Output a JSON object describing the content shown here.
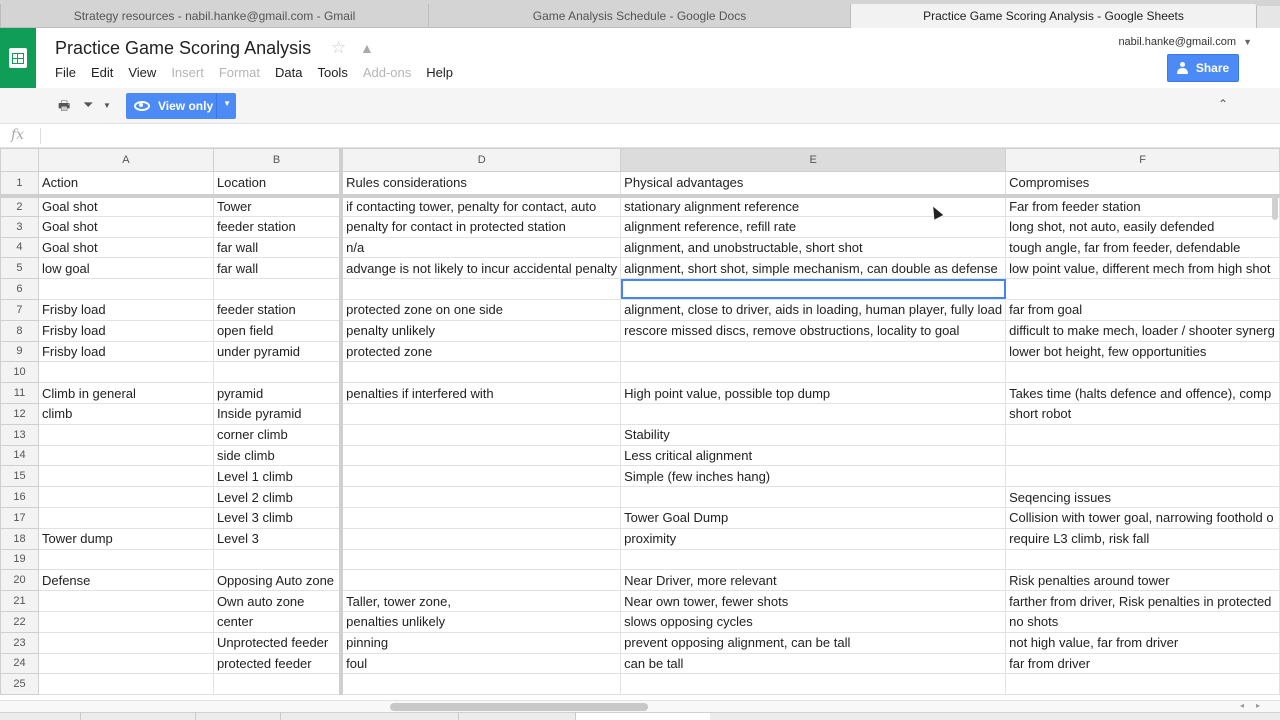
{
  "browser": {
    "tabs": [
      {
        "title": "Strategy resources - nabil.hanke@gmail.com - Gmail",
        "active": false
      },
      {
        "title": "Game Analysis Schedule - Google Docs",
        "active": false
      },
      {
        "title": "Practice Game Scoring Analysis - Google Sheets",
        "active": true
      }
    ]
  },
  "header": {
    "title": "Practice Game Scoring Analysis",
    "user_email": "nabil.hanke@gmail.com",
    "share_label": "Share",
    "menu": [
      {
        "label": "File",
        "enabled": true
      },
      {
        "label": "Edit",
        "enabled": true
      },
      {
        "label": "View",
        "enabled": true
      },
      {
        "label": "Insert",
        "enabled": false
      },
      {
        "label": "Format",
        "enabled": false
      },
      {
        "label": "Data",
        "enabled": true
      },
      {
        "label": "Tools",
        "enabled": true
      },
      {
        "label": "Add-ons",
        "enabled": false
      },
      {
        "label": "Help",
        "enabled": true
      }
    ]
  },
  "toolbar": {
    "view_only_label": "View only"
  },
  "formula_bar": {
    "fx_label": "fx",
    "value": ""
  },
  "sheet": {
    "column_headers": [
      "A",
      "B",
      "D",
      "E",
      "F"
    ],
    "selected_column": "E",
    "selected_cell": {
      "row": 6,
      "col": "E"
    },
    "rows": [
      {
        "num": "1",
        "cells": [
          "Action",
          "Location",
          "Rules considerations",
          "Physical advantages",
          "Compromises"
        ]
      },
      {
        "num": "2",
        "cells": [
          "Goal shot",
          "Tower",
          "if contacting tower, penalty for contact, auto",
          "stationary alignment reference",
          "Far from feeder station"
        ]
      },
      {
        "num": "3",
        "cells": [
          "Goal shot",
          "feeder station",
          "penalty for contact in protected station",
          "alignment reference, refill rate",
          "long shot, not auto, easily defended"
        ]
      },
      {
        "num": "4",
        "cells": [
          "Goal shot",
          "far wall",
          "n/a",
          "alignment, and unobstructable, short shot",
          "tough angle, far from feeder, defendable"
        ]
      },
      {
        "num": "5",
        "cells": [
          "low goal",
          "far wall",
          "advange is not likely to incur accidental penalty",
          "alignment, short shot, simple mechanism, can double as defense",
          "low point value, different mech from high shot"
        ]
      },
      {
        "num": "6",
        "cells": [
          "",
          "",
          "",
          "",
          ""
        ]
      },
      {
        "num": "7",
        "cells": [
          "Frisby load",
          "feeder station",
          "protected zone on one side",
          "alignment, close to driver, aids in loading, human player, fully load",
          "far from goal"
        ]
      },
      {
        "num": "8",
        "cells": [
          "Frisby load",
          "open field",
          "penalty unlikely",
          "rescore missed discs, remove obstructions, locality to goal",
          "difficult to make mech, loader / shooter synerg"
        ]
      },
      {
        "num": "9",
        "cells": [
          "Frisby load",
          "under pyramid",
          "protected zone",
          "",
          "lower bot height, few opportunities"
        ]
      },
      {
        "num": "10",
        "cells": [
          "",
          "",
          "",
          "",
          ""
        ]
      },
      {
        "num": "11",
        "cells": [
          "Climb in general",
          "pyramid",
          "penalties if interfered with",
          "High point value, possible top dump",
          "Takes time (halts defence and offence), comp"
        ]
      },
      {
        "num": "12",
        "cells": [
          "climb",
          "Inside pyramid",
          "",
          "",
          "short robot"
        ]
      },
      {
        "num": "13",
        "cells": [
          "",
          "corner climb",
          "",
          "Stability",
          ""
        ]
      },
      {
        "num": "14",
        "cells": [
          "",
          "side climb",
          "",
          "Less critical alignment",
          ""
        ]
      },
      {
        "num": "15",
        "cells": [
          "",
          "Level 1 climb",
          "",
          "Simple (few inches hang)",
          ""
        ]
      },
      {
        "num": "16",
        "cells": [
          "",
          "Level 2 climb",
          "",
          "",
          "Seqencing issues"
        ]
      },
      {
        "num": "17",
        "cells": [
          "",
          "Level 3 climb",
          "",
          "Tower Goal Dump",
          "Collision with tower goal, narrowing foothold o"
        ]
      },
      {
        "num": "18",
        "cells": [
          "Tower dump",
          "Level 3",
          "",
          "proximity",
          "require L3 climb, risk fall"
        ]
      },
      {
        "num": "19",
        "cells": [
          "",
          "",
          "",
          "",
          ""
        ]
      },
      {
        "num": "20",
        "cells": [
          "Defense",
          "Opposing Auto zone",
          "",
          "Near Driver, more relevant",
          "Risk penalties around tower"
        ]
      },
      {
        "num": "21",
        "cells": [
          "",
          "Own auto zone",
          "Taller, tower zone,",
          "Near own tower, fewer shots",
          "farther from driver, Risk penalties in protected"
        ]
      },
      {
        "num": "22",
        "cells": [
          "",
          "center",
          "penalties unlikely",
          "slows opposing cycles",
          "no shots"
        ]
      },
      {
        "num": "23",
        "cells": [
          "",
          "Unprotected feeder",
          "pinning",
          "prevent opposing alignment, can be tall",
          "not high value, far from driver"
        ]
      },
      {
        "num": "24",
        "cells": [
          "",
          "protected feeder",
          "foul",
          "can be tall",
          "far from driver"
        ]
      },
      {
        "num": "25",
        "cells": [
          "",
          "",
          "",
          "",
          ""
        ]
      }
    ]
  }
}
